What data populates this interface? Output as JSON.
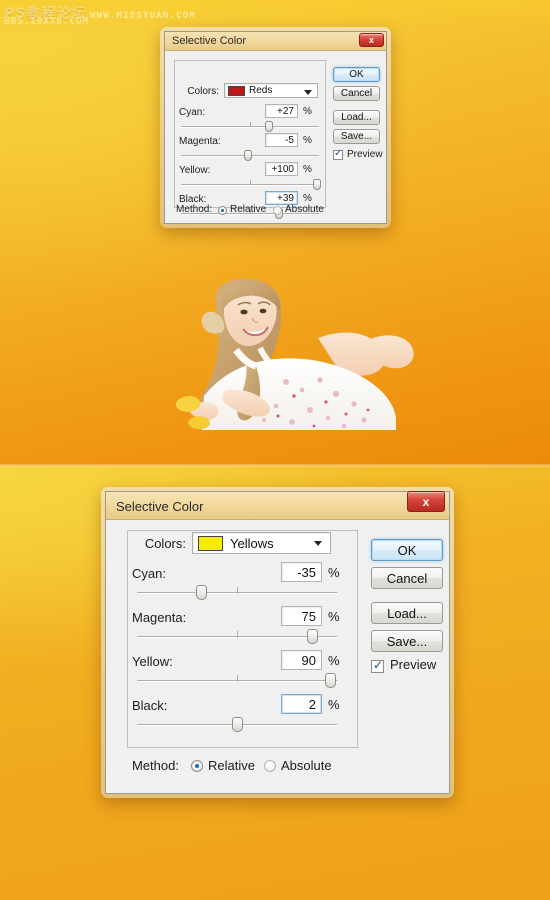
{
  "background": {
    "top_gradient_from": "#f6cf3c",
    "top_gradient_to": "#ec8a0c",
    "bottom_gradient_from": "#f5c832",
    "bottom_gradient_to": "#eea01a"
  },
  "watermark": {
    "cn_text": "PS教程论坛",
    "bbs_text": "BBS.16XX8.COM",
    "url_text": "WWW.MISSYUAN.COM"
  },
  "photo": {
    "alt": "young girl in white floral dress lying down looking upward"
  },
  "dialog_small": {
    "title": "Selective Color",
    "close_label": "x",
    "colors_label": "Colors:",
    "colors_value": "Reds",
    "colors_swatch": "#c01818",
    "sliders": [
      {
        "label": "Cyan:",
        "value": "+27",
        "unit": "%",
        "thumb_pct": 63.5,
        "focused": false
      },
      {
        "label": "Magenta:",
        "value": "-5",
        "unit": "%",
        "thumb_pct": 47.5,
        "focused": false
      },
      {
        "label": "Yellow:",
        "value": "+100",
        "unit": "%",
        "thumb_pct": 100,
        "focused": false
      },
      {
        "label": "Black:",
        "value": "+39",
        "unit": "%",
        "thumb_pct": 69.5,
        "focused": true
      }
    ],
    "buttons": [
      {
        "label": "OK",
        "primary": true
      },
      {
        "label": "Cancel",
        "primary": false
      },
      {
        "label": "Load...",
        "primary": false
      },
      {
        "label": "Save...",
        "primary": false
      }
    ],
    "preview_label": "Preview",
    "preview_checked": true,
    "preview_check_glyph": "✓",
    "method_label": "Method:",
    "method_options": [
      {
        "label": "Relative",
        "selected": true
      },
      {
        "label": "Absolute",
        "selected": false
      }
    ]
  },
  "dialog_large": {
    "title": "Selective Color",
    "close_label": "x",
    "colors_label": "Colors:",
    "colors_value": "Yellows",
    "colors_swatch": "#f7ec00",
    "sliders": [
      {
        "label": "Cyan:",
        "value": "-35",
        "unit": "%",
        "thumb_pct": 32.5,
        "focused": false
      },
      {
        "label": "Magenta:",
        "value": "75",
        "unit": "%",
        "thumb_pct": 87.5,
        "focused": false
      },
      {
        "label": "Yellow:",
        "value": "90",
        "unit": "%",
        "thumb_pct": 95.5,
        "focused": false
      },
      {
        "label": "Black:",
        "value": "2",
        "unit": "%",
        "thumb_pct": 51.0,
        "focused": true
      }
    ],
    "buttons": [
      {
        "label": "OK",
        "primary": true
      },
      {
        "label": "Cancel",
        "primary": false
      },
      {
        "label": "Load...",
        "primary": false
      },
      {
        "label": "Save...",
        "primary": false
      }
    ],
    "preview_label": "Preview",
    "preview_checked": true,
    "preview_check_glyph": "✓",
    "method_label": "Method:",
    "method_options": [
      {
        "label": "Relative",
        "selected": true
      },
      {
        "label": "Absolute",
        "selected": false
      }
    ]
  }
}
